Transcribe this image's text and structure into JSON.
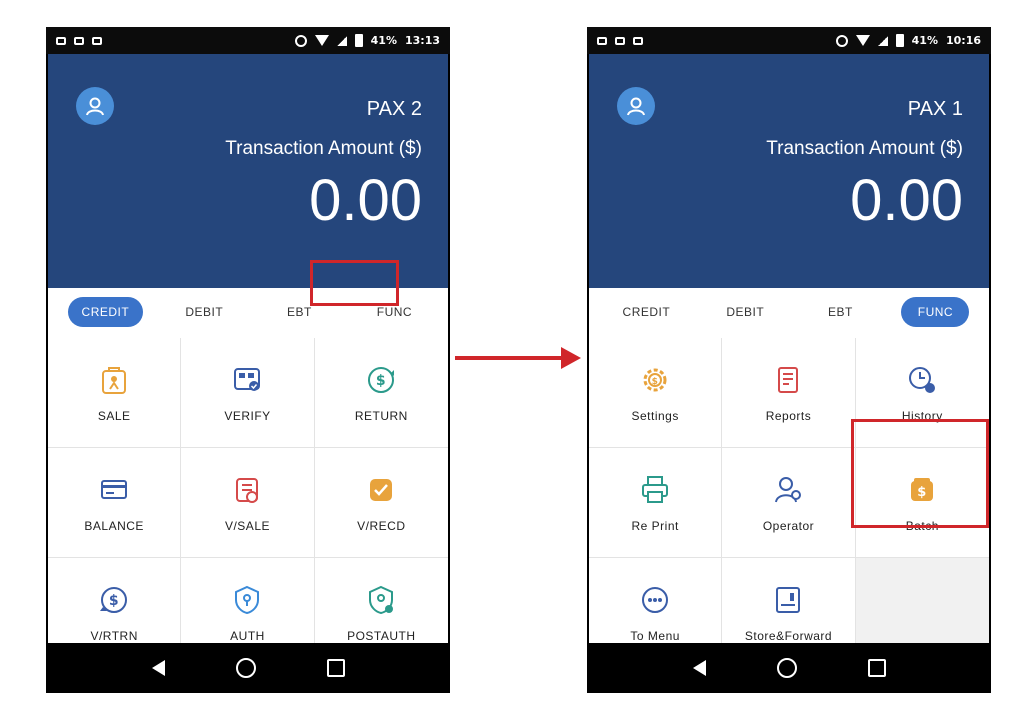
{
  "left_screen": {
    "status_time": "13:13",
    "status_battery": "41%",
    "pax": "PAX 2",
    "amount_label": "Transaction Amount ($)",
    "amount_value": "0.00",
    "tabs": [
      "CREDIT",
      "DEBIT",
      "EBT",
      "FUNC"
    ],
    "active_tab": "CREDIT",
    "highlighted_tab": "FUNC",
    "tiles": [
      {
        "label": "SALE",
        "icon": "sale-bag-icon",
        "color": "#e8a33c"
      },
      {
        "label": "VERIFY",
        "icon": "verify-card-icon",
        "color": "#3a5da8"
      },
      {
        "label": "RETURN",
        "icon": "return-dollar-icon",
        "color": "#2b9a8b"
      },
      {
        "label": "BALANCE",
        "icon": "balance-card-icon",
        "color": "#3a5da8"
      },
      {
        "label": "V/SALE",
        "icon": "void-sale-icon",
        "color": "#d54a4a"
      },
      {
        "label": "V/RECD",
        "icon": "void-record-icon",
        "color": "#e8a33c"
      },
      {
        "label": "V/RTRN",
        "icon": "void-return-icon",
        "color": "#3a5da8"
      },
      {
        "label": "AUTH",
        "icon": "auth-shield-icon",
        "color": "#3a8ad8"
      },
      {
        "label": "POSTAUTH",
        "icon": "postauth-shield-icon",
        "color": "#2b9a8b"
      }
    ]
  },
  "right_screen": {
    "status_time": "10:16",
    "status_battery": "41%",
    "pax": "PAX 1",
    "amount_label": "Transaction Amount ($)",
    "amount_value": "0.00",
    "tabs": [
      "CREDIT",
      "DEBIT",
      "EBT",
      "FUNC"
    ],
    "active_tab": "FUNC",
    "tiles": [
      {
        "label": "Settings",
        "icon": "settings-gear-icon",
        "color": "#e8a33c"
      },
      {
        "label": "Reports",
        "icon": "reports-doc-icon",
        "color": "#d54a4a"
      },
      {
        "label": "History",
        "icon": "history-clock-icon",
        "color": "#3a5da8"
      },
      {
        "label": "Re Print",
        "icon": "printer-icon",
        "color": "#2b9a8b"
      },
      {
        "label": "Operator",
        "icon": "operator-user-icon",
        "color": "#3a5da8"
      },
      {
        "label": "Batch",
        "icon": "batch-dollar-icon",
        "color": "#e8a33c"
      },
      {
        "label": "To Menu",
        "icon": "menu-dots-icon",
        "color": "#3a5da8"
      },
      {
        "label": "Store&Forward",
        "icon": "store-forward-icon",
        "color": "#3a5da8"
      },
      {
        "label": "",
        "icon": "",
        "color": "#f1f1f1"
      }
    ],
    "highlighted_tile": "Batch"
  },
  "colors": {
    "header": "#25467c",
    "active_tab": "#3a73c9",
    "highlight": "#d0262a"
  }
}
